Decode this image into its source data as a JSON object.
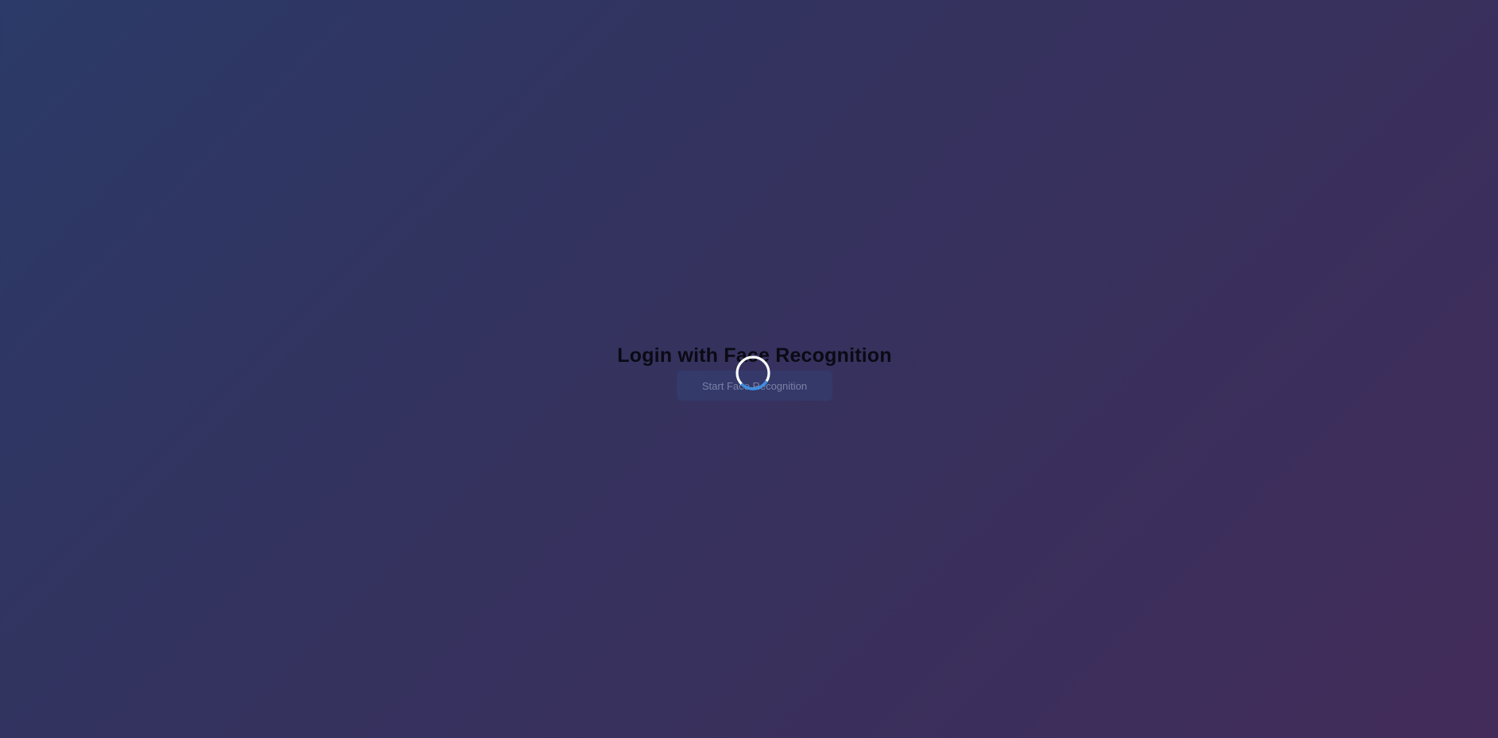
{
  "login": {
    "title": "Login with Face Recognition",
    "start_button_label": "Start Face Recognition"
  },
  "loading": {
    "spinner_icon": "loading-spinner-icon",
    "ring_color": "#ffffff",
    "arc_color": "#3b8ee0"
  },
  "colors": {
    "background_start": "#2b3a68",
    "background_end": "#432c5a"
  }
}
